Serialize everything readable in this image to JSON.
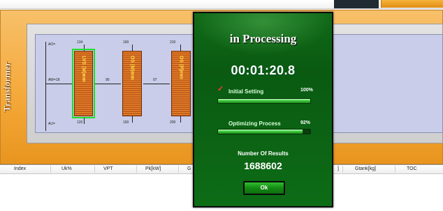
{
  "panel": {
    "side_label": "Transformer"
  },
  "diagram": {
    "aw_label": "AW=18",
    "ao_label": "AO=",
    "au_label": "AU=",
    "gap1": "90",
    "gap2": "97",
    "coils": [
      {
        "label": "LVS (M)mm",
        "top": "134",
        "bottom": "120",
        "selected": true
      },
      {
        "label": "OS (M)mm",
        "top": "160",
        "bottom": "150",
        "selected": false
      },
      {
        "label": "OS (P)mm",
        "top": "210",
        "bottom": "200",
        "selected": false
      }
    ]
  },
  "table": {
    "columns_left": [
      "Index",
      "Uk%",
      "VPT",
      "Pk[kW]",
      "G"
    ],
    "columns_right": [
      "]",
      "Gtank[kg]",
      "TOC"
    ]
  },
  "dialog": {
    "title": "in Processing",
    "timer": "00:01:20.8",
    "steps": [
      {
        "label": "Initial Setting",
        "percent": "100%",
        "progress": 1.0
      },
      {
        "label": "Optimizing Process",
        "percent": "92%",
        "progress": 0.92
      }
    ],
    "results_label": "Number Of Results",
    "results_value": "1688602",
    "ok_label": "Ok"
  }
}
